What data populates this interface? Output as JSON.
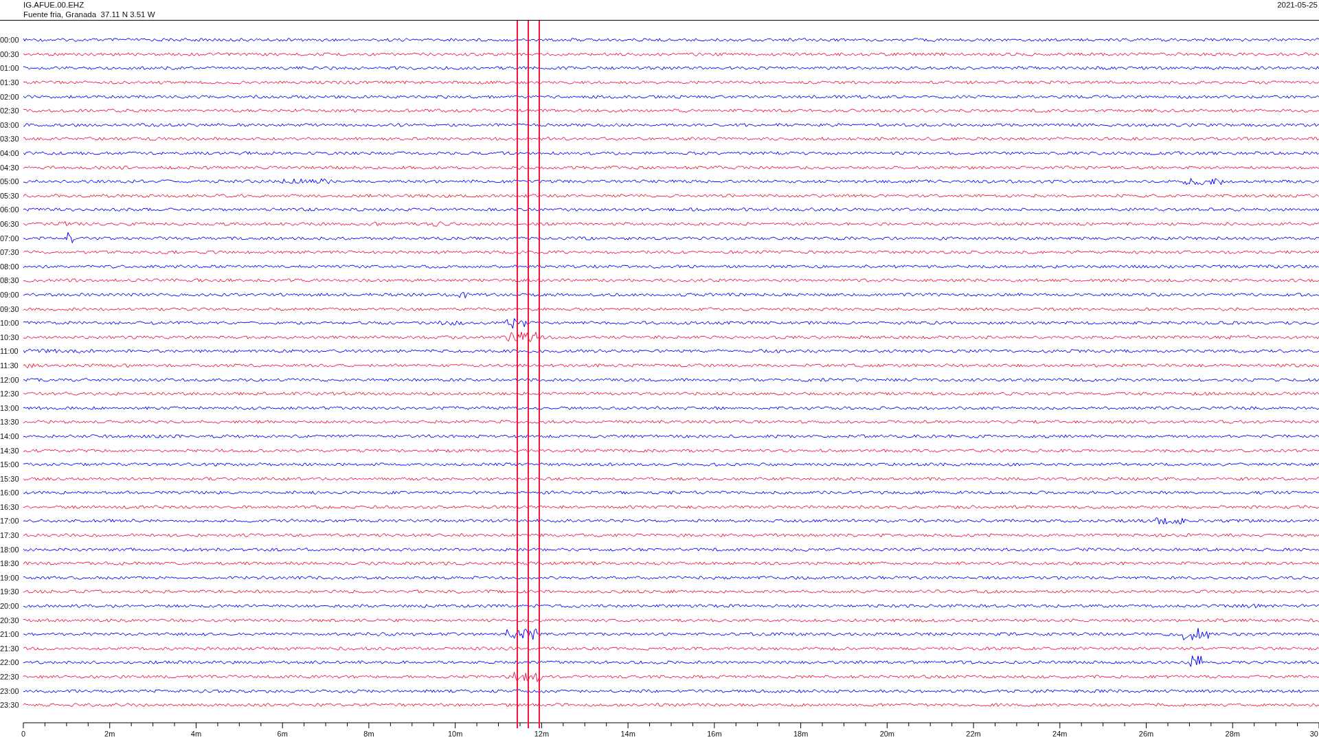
{
  "station": {
    "code": "IG.AFUE.00.EHZ",
    "location": "Fuente fria, Granada  37.11 N 3.51 W",
    "date": "2021-05-25"
  },
  "traces": [
    {
      "label": "00:00",
      "color": "#0000ff"
    },
    {
      "label": "00:30",
      "color": "#f0143c"
    },
    {
      "label": "01:00",
      "color": "#0000ff"
    },
    {
      "label": "01:30",
      "color": "#f0143c"
    },
    {
      "label": "02:00",
      "color": "#0000ff"
    },
    {
      "label": "02:30",
      "color": "#f0143c"
    },
    {
      "label": "03:00",
      "color": "#0000ff"
    },
    {
      "label": "03:30",
      "color": "#f0143c"
    },
    {
      "label": "04:00",
      "color": "#0000ff"
    },
    {
      "label": "04:30",
      "color": "#f0143c"
    },
    {
      "label": "05:00",
      "color": "#0000ff"
    },
    {
      "label": "05:30",
      "color": "#f0143c"
    },
    {
      "label": "06:00",
      "color": "#0000ff"
    },
    {
      "label": "06:30",
      "color": "#f0143c"
    },
    {
      "label": "07:00",
      "color": "#0000ff"
    },
    {
      "label": "07:30",
      "color": "#f0143c"
    },
    {
      "label": "08:00",
      "color": "#0000ff"
    },
    {
      "label": "08:30",
      "color": "#f0143c"
    },
    {
      "label": "09:00",
      "color": "#0000ff"
    },
    {
      "label": "09:30",
      "color": "#f0143c"
    },
    {
      "label": "10:00",
      "color": "#0000ff"
    },
    {
      "label": "10:30",
      "color": "#f0143c"
    },
    {
      "label": "11:00",
      "color": "#0000ff"
    },
    {
      "label": "11:30",
      "color": "#f0143c"
    },
    {
      "label": "12:00",
      "color": "#0000ff"
    },
    {
      "label": "12:30",
      "color": "#f0143c"
    },
    {
      "label": "13:00",
      "color": "#0000ff"
    },
    {
      "label": "13:30",
      "color": "#f0143c"
    },
    {
      "label": "14:00",
      "color": "#0000ff"
    },
    {
      "label": "14:30",
      "color": "#f0143c"
    },
    {
      "label": "15:00",
      "color": "#0000ff"
    },
    {
      "label": "15:30",
      "color": "#f0143c"
    },
    {
      "label": "16:00",
      "color": "#0000ff"
    },
    {
      "label": "16:30",
      "color": "#f0143c"
    },
    {
      "label": "17:00",
      "color": "#0000ff"
    },
    {
      "label": "17:30",
      "color": "#f0143c"
    },
    {
      "label": "18:00",
      "color": "#0000ff"
    },
    {
      "label": "18:30",
      "color": "#f0143c"
    },
    {
      "label": "19:00",
      "color": "#0000ff"
    },
    {
      "label": "19:30",
      "color": "#f0143c"
    },
    {
      "label": "20:00",
      "color": "#0000ff"
    },
    {
      "label": "20:30",
      "color": "#f0143c"
    },
    {
      "label": "21:00",
      "color": "#0000ff"
    },
    {
      "label": "21:30",
      "color": "#f0143c"
    },
    {
      "label": "22:00",
      "color": "#0000ff"
    },
    {
      "label": "22:30",
      "color": "#f0143c"
    },
    {
      "label": "23:00",
      "color": "#0000ff"
    },
    {
      "label": "23:30",
      "color": "#f0143c"
    }
  ],
  "x_axis": {
    "ticks": [
      "0",
      "2m",
      "4m",
      "6m",
      "8m",
      "10m",
      "12m",
      "14m",
      "16m",
      "18m",
      "20m",
      "22m",
      "24m",
      "26m",
      "28m",
      "30"
    ]
  }
}
